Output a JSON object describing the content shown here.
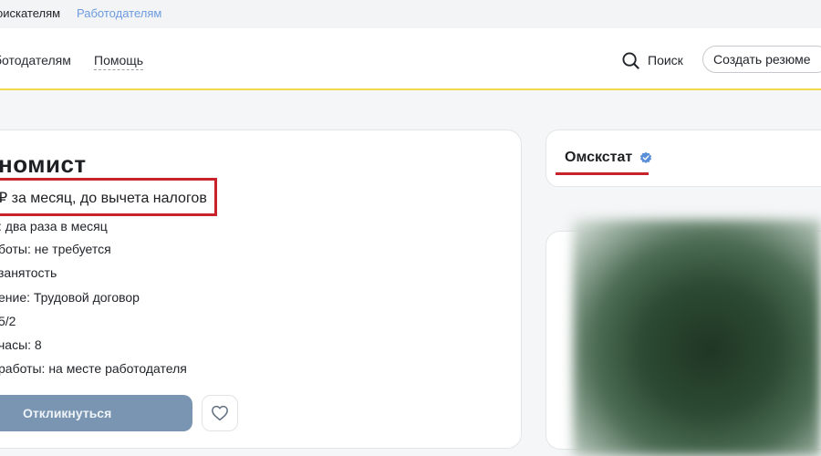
{
  "topbar": {
    "tab_jobseekers": "оискателям",
    "tab_employers": "Работодателям"
  },
  "header": {
    "nav": [
      "ботодателям",
      "Помощь"
    ],
    "search_label": "Поиск",
    "create_resume_label": "Создать резюме"
  },
  "vacancy": {
    "title": "номист",
    "salary": "₽ за месяц, до вычета налогов",
    "details": [
      ": два раза в месяц",
      "боты: не требуется",
      "занятость",
      "ение: Трудовой договор",
      "5/2",
      " часы: 8",
      "работы: на месте работодателя"
    ],
    "apply_label": "Откликнуться"
  },
  "employer": {
    "name": "Омскстат",
    "verified": true
  },
  "colors": {
    "accent_red": "#c8232c",
    "apply_button": "#7a95b1",
    "header_underline": "#f0d94b",
    "link_blue": "#6d9be0",
    "verified_badge": "#5a8fd8"
  },
  "icons": {
    "search": "search-icon",
    "favorite": "heart-icon",
    "verified": "verified-badge-icon"
  }
}
